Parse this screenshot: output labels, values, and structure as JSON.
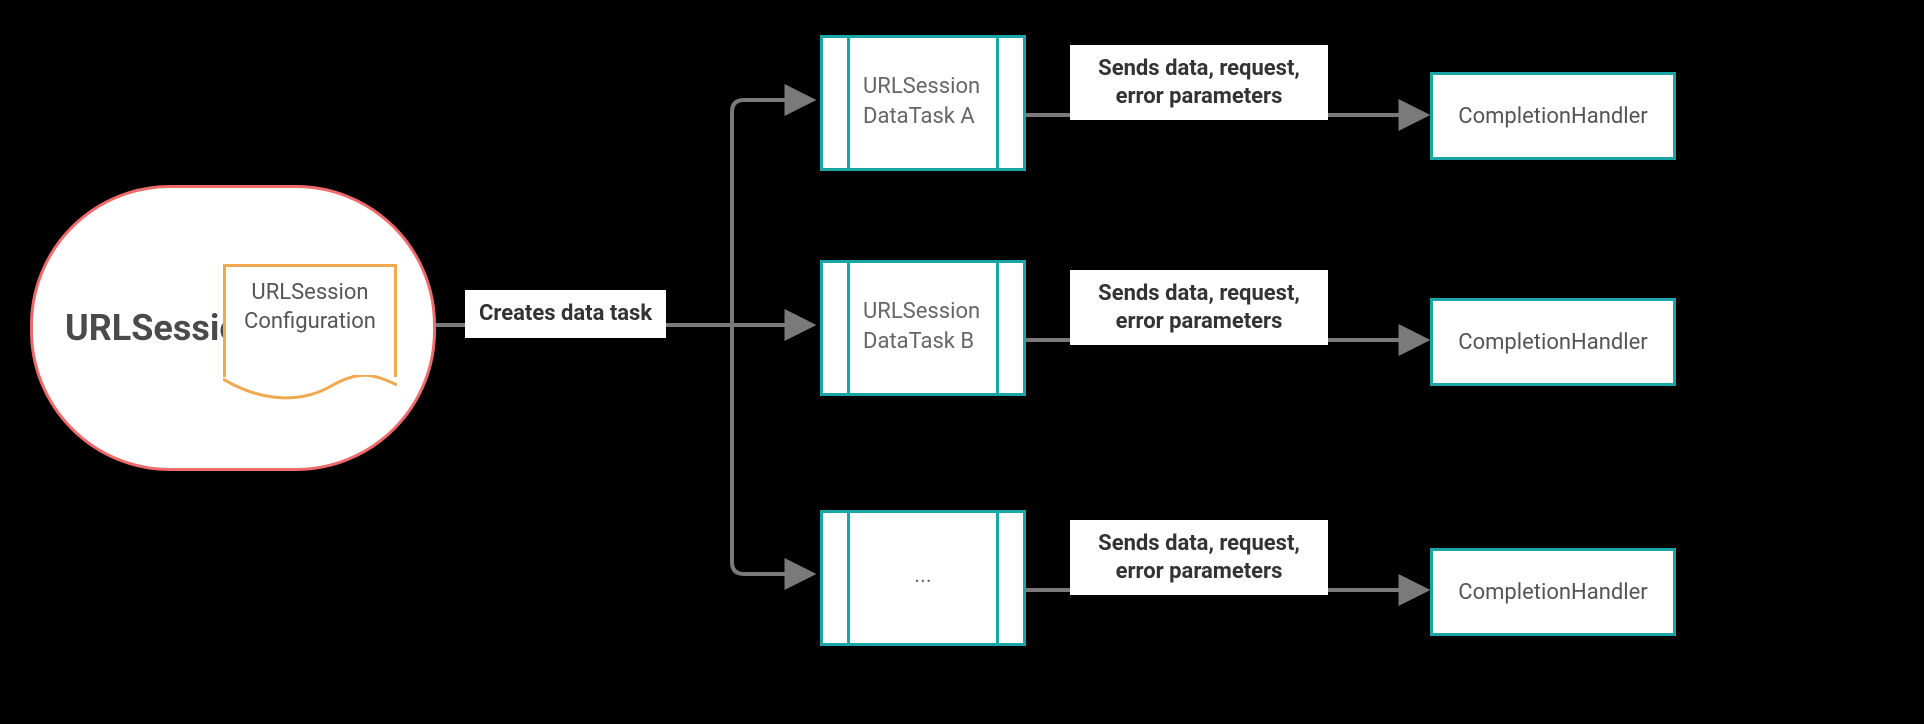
{
  "session": {
    "title": "URLSession",
    "config_label_1": "URLSession",
    "config_label_2": "Configuration"
  },
  "create_label": "Creates data task",
  "tasks": [
    {
      "line1": "URLSession",
      "line2": "DataTask  A"
    },
    {
      "line1": "URLSession",
      "line2": "DataTask  B"
    },
    {
      "ellipsis": "..."
    }
  ],
  "send_label_1": "Sends data, request,",
  "send_label_2": "error parameters",
  "handler_label": "CompletionHandler"
}
